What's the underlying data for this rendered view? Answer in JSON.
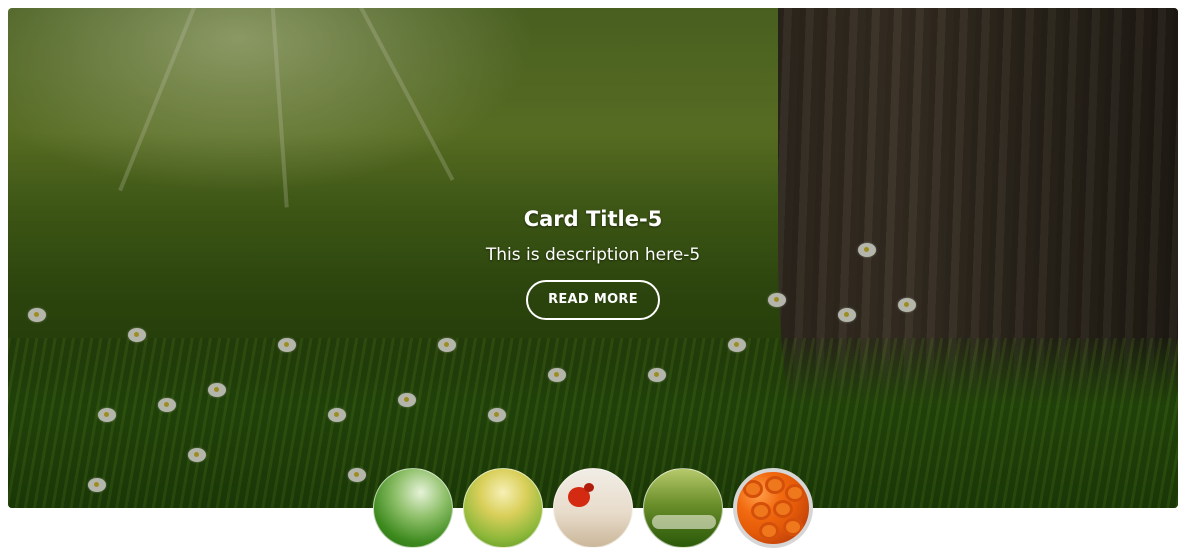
{
  "slide": {
    "title": "Card Title-5",
    "description": "This is description here-5",
    "button_label": "READ MORE"
  },
  "thumbnails": [
    {
      "name": "grass-close-up",
      "active": false
    },
    {
      "name": "yellow-field",
      "active": false
    },
    {
      "name": "red-poppy",
      "active": false
    },
    {
      "name": "meadow-flowers",
      "active": false
    },
    {
      "name": "orange-roses",
      "active": true
    }
  ],
  "colors": {
    "text": "#ffffff",
    "active_thumb_border": "#d6d6d6",
    "page_background": "#ffffff"
  }
}
